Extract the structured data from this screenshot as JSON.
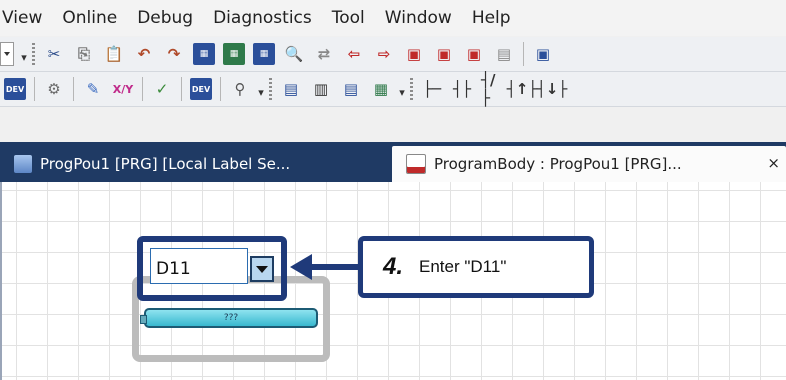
{
  "menu": [
    "View",
    "Online",
    "Debug",
    "Diagnostics",
    "Tool",
    "Window",
    "Help"
  ],
  "tabs": {
    "local_label": "ProgPou1 [PRG] [Local Label Se...",
    "program_body": "ProgramBody : ProgPou1 [PRG]...",
    "close_glyph": "×"
  },
  "editor": {
    "label_value": "D11",
    "block_text": "???"
  },
  "callout": {
    "step": "4.",
    "text": "Enter \"D11\""
  },
  "toolbar1_icons": [
    "scissors-icon",
    "copy-icon",
    "paste-icon",
    "undo-icon",
    "redo-icon",
    "convert-icon",
    "convert-online-icon",
    "convert-all-icon",
    "find-icon",
    "replace-icon",
    "read-from-plc-icon",
    "write-to-plc-icon",
    "verify-icon",
    "monitor-icon",
    "monitor-stop-icon",
    "device-batch-icon",
    "monitor-window-icon"
  ],
  "toolbar2_icons": [
    "device-comment-icon",
    "parameter-icon",
    "program-check-icon",
    "cross-reference-icon",
    "device-list-icon",
    "device-display-icon",
    "zoom-icon",
    "ladder-mode-icon",
    "read-mode-icon",
    "write-mode-icon",
    "label-icon",
    "contact-icon",
    "contact-nc-icon",
    "rising-edge-icon",
    "falling-edge-icon"
  ],
  "colors": {
    "accent_navy": "#1f3a7a",
    "tab_bar": "#1f3a64",
    "block_cyan": "#38b8cf"
  }
}
